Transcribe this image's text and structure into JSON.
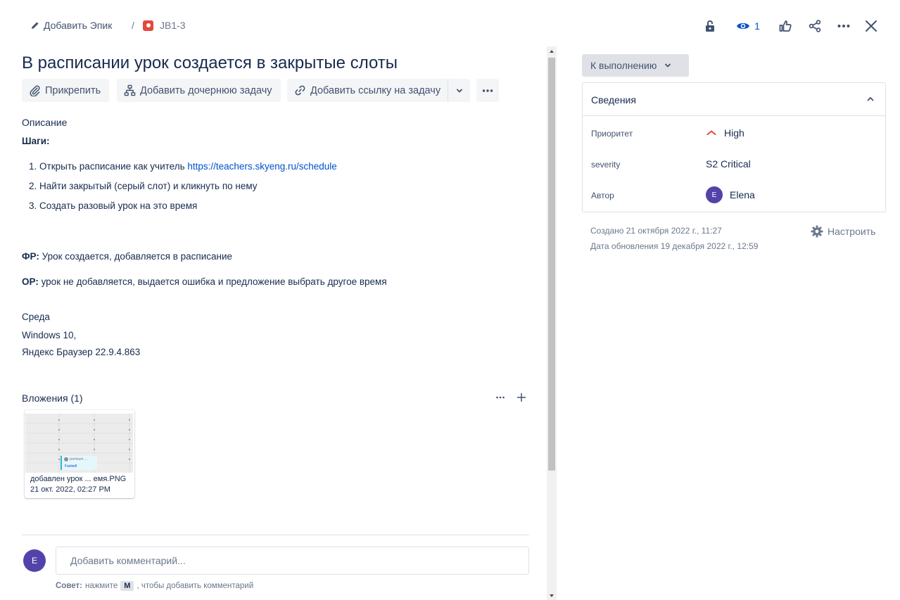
{
  "breadcrumb": {
    "add_epic_label": "Добавить Эпик",
    "separator": "/",
    "issue_key": "JB1-3"
  },
  "top_actions": {
    "watch_count": "1"
  },
  "issue": {
    "title": "В расписании урок создается в закрытые слоты"
  },
  "toolbar": {
    "attach_label": "Прикрепить",
    "add_child_label": "Добавить дочернюю задачу",
    "add_link_label": "Добавить ссылку на задачу"
  },
  "description": {
    "label": "Описание",
    "steps_heading": "Шаги:",
    "steps": [
      {
        "num": "1.",
        "text": "Открыть расписание как учитель ",
        "link": "https://teachers.skyeng.ru/schedule"
      },
      {
        "num": "2.",
        "text": "Найти закрытый (серый слот) и кликнуть по нему"
      },
      {
        "num": "3.",
        "text": "Создать разовый урок на это время"
      }
    ],
    "fr_label": "ФР:",
    "fr_text": " Урок создается, добавляется в расписание",
    "or_label": "ОР:",
    "or_text": " урок не добавляется, выдается ошибка и предложение выбрать другое время",
    "env_label": "Среда",
    "env_lines": [
      "Windows 10,",
      "Яндекс Браузер 22.9.4.863"
    ]
  },
  "attachments": {
    "label": "Вложения (1)",
    "items": [
      {
        "name": "добавлен урок ... емя.PNG",
        "date": "21 окт. 2022, 02:27 PM",
        "preview_text": "premium ...",
        "preview_sub": "Fastsell"
      }
    ]
  },
  "comment": {
    "avatar_initial": "E",
    "placeholder": "Добавить комментарий...",
    "tip_prefix": "Совет:",
    "tip_middle": " нажмите ",
    "tip_key": "M",
    "tip_suffix": ", чтобы добавить комментарий"
  },
  "status": {
    "label": "К выполнению"
  },
  "details": {
    "title": "Сведения",
    "fields": [
      {
        "label": "Приоритет",
        "value": "High",
        "icon": "priority-high-icon"
      },
      {
        "label": "severity",
        "value": "S2 Critical"
      },
      {
        "label": "Автор",
        "value": "Elena",
        "avatar_initial": "E"
      }
    ]
  },
  "meta": {
    "created": "Создано 21 октября 2022 г., 11:27",
    "updated": "Дата обновления 19 декабря 2022 г., 12:59",
    "configure_label": "Настроить"
  },
  "colors": {
    "accent": "#0052cc",
    "bug": "#e5493a",
    "priority_high": "#e5493a",
    "avatar": "#5243aa"
  }
}
